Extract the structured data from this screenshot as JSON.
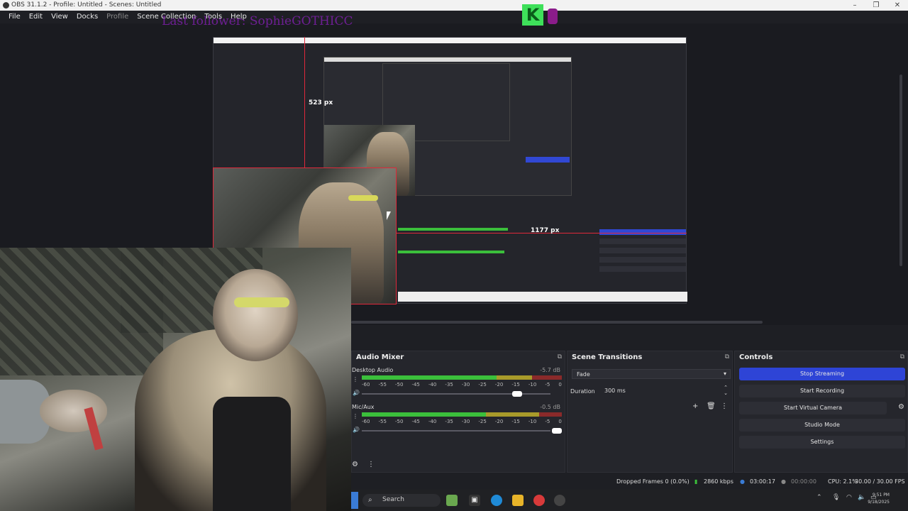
{
  "window": {
    "title": "OBS 31.1.2 - Profile: Untitled - Scenes: Untitled",
    "controls": [
      "–",
      "❐",
      "✕"
    ]
  },
  "menu": {
    "items": [
      "File",
      "Edit",
      "View",
      "Docks",
      "Profile",
      "Scene Collection",
      "Tools",
      "Help"
    ]
  },
  "overlay": {
    "last_follower": "Last follower: SophieGOTHICC"
  },
  "preview": {
    "height_label": "523 px",
    "width_label": "1177 px"
  },
  "audio_mixer": {
    "title": "Audio Mixer",
    "channels": [
      {
        "name": "Desktop Audio",
        "db": "-5.7 dB",
        "level": 0.73,
        "volume": 0.8
      },
      {
        "name": "Mic/Aux",
        "db": "-0.5 dB",
        "level": 0.58,
        "volume": 0.98
      }
    ],
    "ticks": [
      "-60",
      "-55",
      "-50",
      "-45",
      "-40",
      "-35",
      "-30",
      "-25",
      "-20",
      "-15",
      "-10",
      "-5",
      "0"
    ]
  },
  "scene_transitions": {
    "title": "Scene Transitions",
    "transition": "Fade",
    "duration_label": "Duration",
    "duration_value": "300 ms"
  },
  "controls": {
    "title": "Controls",
    "buttons": [
      "Stop Streaming",
      "Start Recording",
      "Start Virtual Camera",
      "Studio Mode",
      "Settings"
    ]
  },
  "status": {
    "dropped_frames": "Dropped Frames 0 (0.0%)",
    "bitrate": "2860 kbps",
    "stream_time": "03:00:17",
    "record_time": "00:00:00",
    "cpu": "CPU: 2.1%",
    "fps": "30.00 / 30.00 FPS"
  },
  "taskbar": {
    "search_placeholder": "Search",
    "time": "9:51 PM",
    "date": "9/18/2025"
  },
  "colors": {
    "accent_blue": "#2e44d6",
    "selection_red": "#e0283a",
    "overlay_purple": "#7c1fa8",
    "meter_green": "#3bbf3b"
  }
}
